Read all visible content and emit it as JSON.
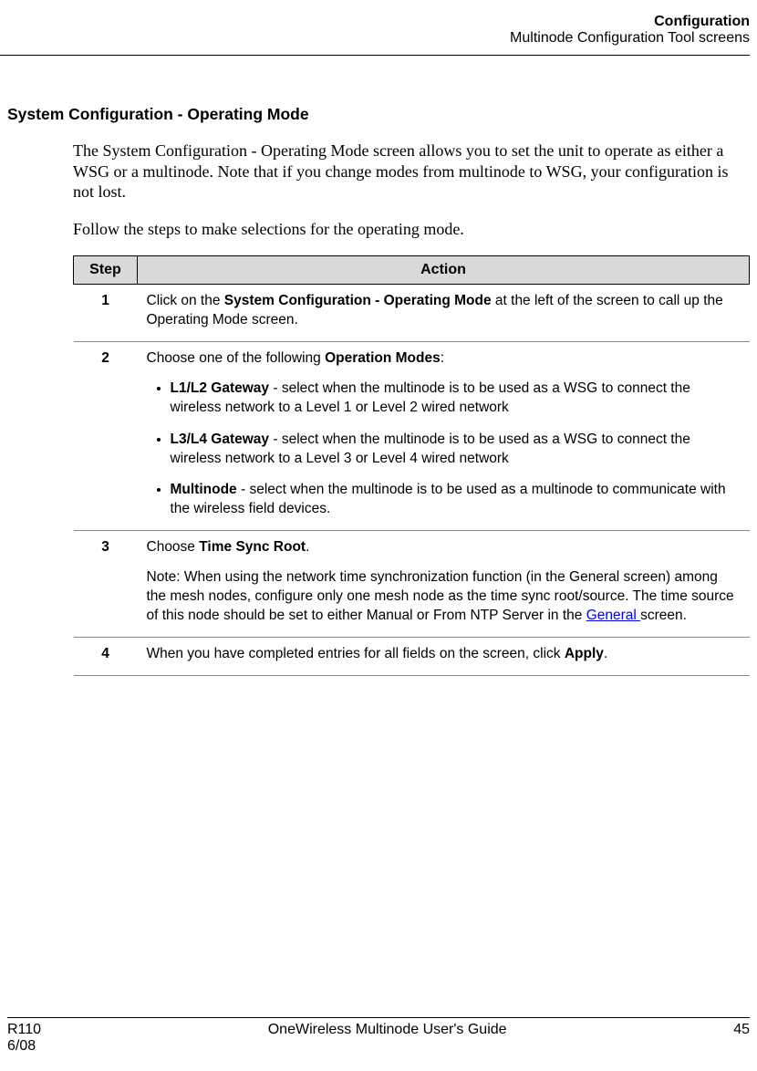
{
  "header": {
    "title": "Configuration",
    "subtitle": "Multinode Configuration Tool screens"
  },
  "section": {
    "heading": "System Configuration - Operating Mode",
    "intro": "The System Configuration - Operating Mode screen allows you to set the unit to operate as either a WSG or a multinode.  Note that if you change modes from multinode to WSG, your configuration is not lost.",
    "follow": "Follow the steps to make selections for the operating mode."
  },
  "table": {
    "headers": {
      "step": "Step",
      "action": "Action"
    },
    "rows": [
      {
        "num": "1",
        "pre": "Click on the ",
        "bold": "System Configuration - Operating Mode",
        "post": " at the left of the screen to call up the Operating Mode screen."
      },
      {
        "num": "2",
        "pre": "Choose one of the following ",
        "bold": "Operation Modes",
        "post": ":",
        "bullets": [
          {
            "bold": "L1/L2 Gateway",
            "text": " - select when the multinode is to be used as a WSG to connect the wireless network to a Level 1 or Level 2 wired network"
          },
          {
            "bold": "L3/L4 Gateway",
            "text": " - select when the multinode is to be used as a WSG to connect the wireless network to a Level 3 or Level 4 wired network"
          },
          {
            "bold": "Multinode",
            "text": " - select when the multinode is to be used as a multinode to communicate with the wireless field devices."
          }
        ]
      },
      {
        "num": "3",
        "pre": "Choose ",
        "bold": "Time Sync Root",
        "post": ".",
        "note_pre": "Note:  When using the network time synchronization function (in the General screen) among the mesh nodes, configure only one mesh node as the time sync root/source.  The time source of this node should be set to either Manual or From NTP Server in the ",
        "note_link": "General ",
        "note_post": "screen."
      },
      {
        "num": "4",
        "pre": "When you have completed entries for all fields on the screen, click ",
        "bold": "Apply",
        "post": "."
      }
    ]
  },
  "footer": {
    "left1": "R110",
    "left2": "6/08",
    "center": "OneWireless Multinode User's Guide",
    "right": "45"
  }
}
